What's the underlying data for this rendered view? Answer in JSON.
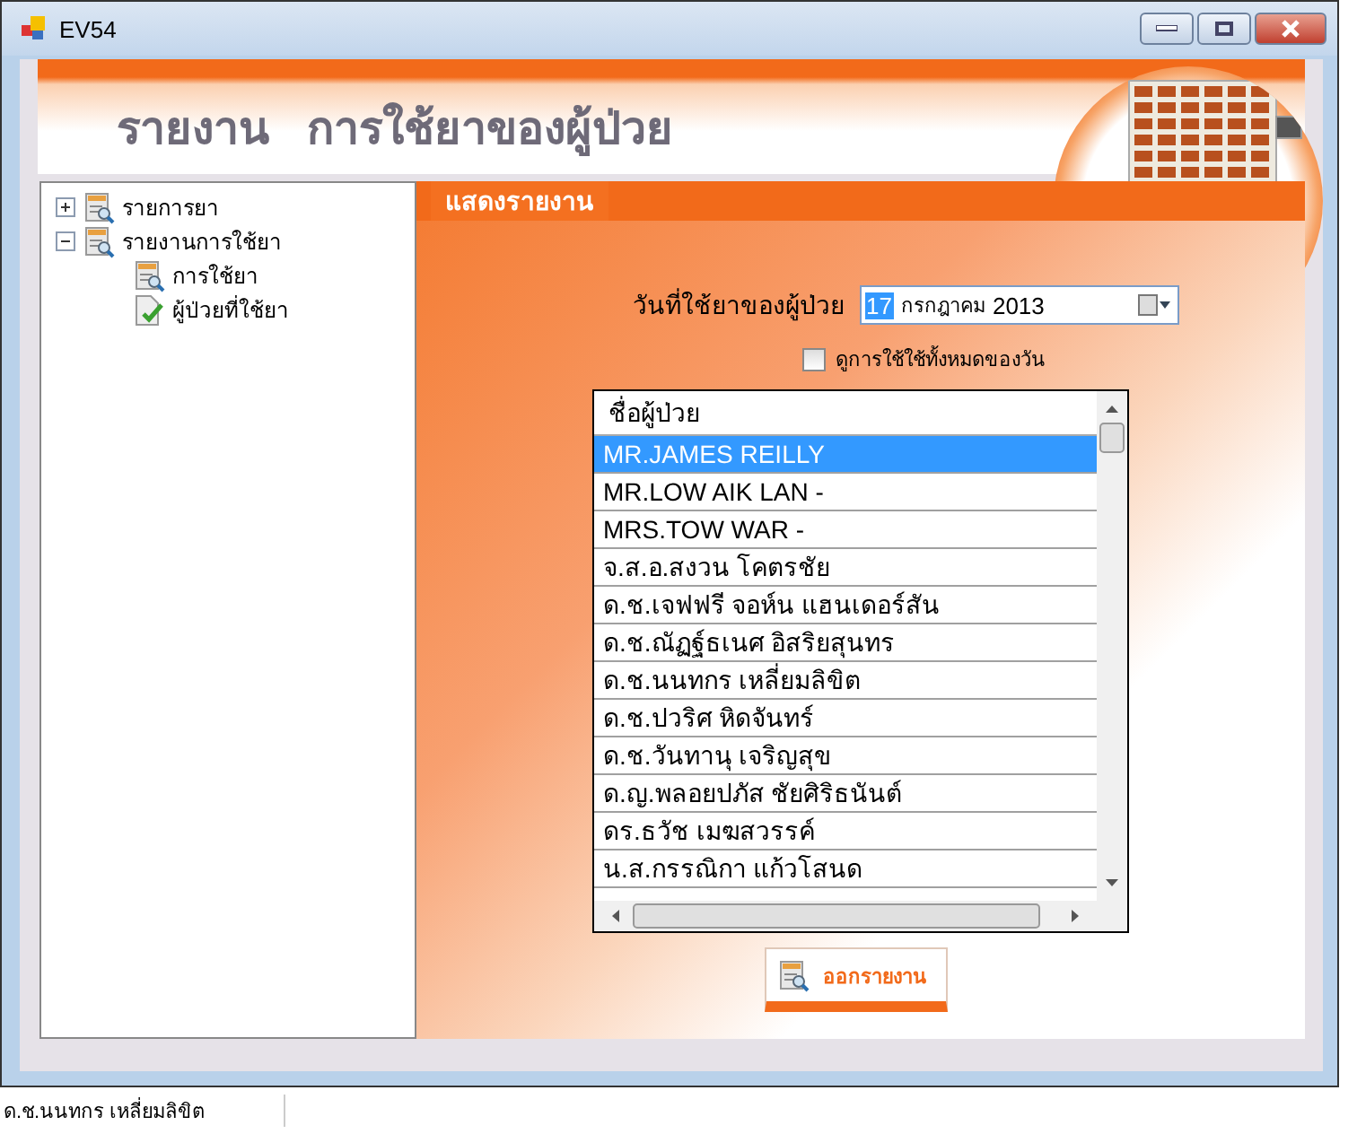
{
  "window": {
    "title": "EV54"
  },
  "header": {
    "title": "รายงาน   การใช้ยาของผู้ป่วย"
  },
  "tree": [
    {
      "label": "รายการยา",
      "kind": "report",
      "expanded": false
    },
    {
      "label": "รายงานการใช้ยา",
      "kind": "report",
      "expanded": true,
      "children": [
        {
          "label": "การใช้ยา",
          "kind": "report"
        },
        {
          "label": "ผู้ป่วยที่ใช้ยา",
          "kind": "checked"
        }
      ]
    }
  ],
  "panel": {
    "title": "แสดงรายงาน"
  },
  "date": {
    "label": "วันที่ใช้ยาของผู้ป่วย",
    "day": "17",
    "day_selected": true,
    "month": "กรกฎาคม",
    "year": "2013"
  },
  "all_day": {
    "label": "ดูการใช้ใช้ทั้งหมดของวัน",
    "checked": false
  },
  "patients": {
    "header": "ชื่อผู้ป่วย",
    "rows": [
      {
        "name": "MR.JAMES REILLY",
        "selected": true
      },
      {
        "name": "MR.LOW AIK LAN -",
        "selected": false
      },
      {
        "name": "MRS.TOW WAR -",
        "selected": false
      },
      {
        "name": "จ.ส.อ.สงวน โคตรชัย",
        "selected": false
      },
      {
        "name": "ด.ช.เจฟฟรี จอห์น แฮนเดอร์สัน",
        "selected": false
      },
      {
        "name": "ด.ช.ณัฏฐ์ธเนศ อิสริยสุนทร",
        "selected": false
      },
      {
        "name": "ด.ช.นนทกร เหลี่ยมลิขิต",
        "selected": false
      },
      {
        "name": "ด.ช.ปวริศ หิดจันทร์",
        "selected": false
      },
      {
        "name": "ด.ช.วันทานุ เจริญสุข",
        "selected": false
      },
      {
        "name": "ด.ญ.พลอยปภัส ชัยศิริธนันต์",
        "selected": false
      },
      {
        "name": "ดร.ธวัช เมฆสวรรค์",
        "selected": false
      },
      {
        "name": "น.ส.กรรณิกา แก้วโสนด",
        "selected": false
      }
    ]
  },
  "report_button": {
    "label": "ออกรายงาน"
  },
  "background_row": {
    "text": "ด.ช.นนทกร เหลี่ยมลิขิต"
  }
}
